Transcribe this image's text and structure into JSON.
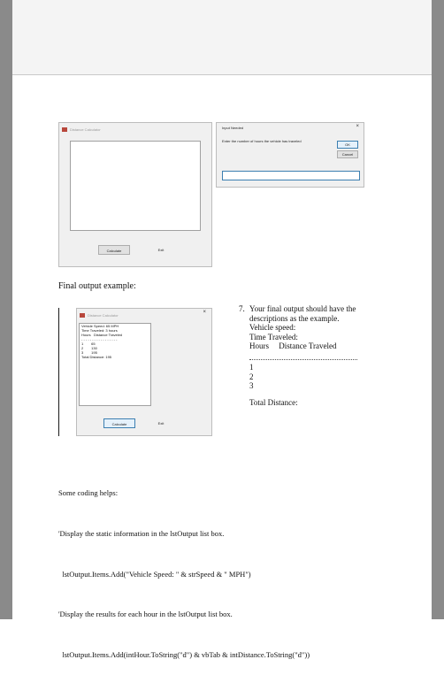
{
  "calc_window": {
    "title": "Distance Calculator",
    "calculate_label": "Calculate",
    "exit_label": "Exit"
  },
  "input_dialog": {
    "title": "Input Needed",
    "close_glyph": "×",
    "prompt": "Enter the number of hours the vehicle has traveled",
    "ok_label": "OK",
    "cancel_label": "Cancel"
  },
  "final_label": "Final output example:",
  "final_window": {
    "title": "Distance Calculator",
    "close_glyph": "×",
    "list_lines": [
      "Vehicle Speed: 65 MPH",
      "Time Traveled: 3 hours",
      "Hours   Distance Traveled",
      "- - - - - - - - - - - - - - - - -",
      "1        65",
      "2        130",
      "3        195",
      "Total Distance: 195"
    ],
    "calculate_label": "Calculate",
    "exit_label": "Exit"
  },
  "note": {
    "number": "7.",
    "lines": [
      "Your final output should have the",
      "descriptions as the example.",
      "Vehicle speed:",
      "Time Traveled:",
      "Hours     Distance Traveled"
    ],
    "hours": [
      "1",
      "2",
      "3"
    ],
    "total": "Total Distance:"
  },
  "helps": [
    "Some coding helps:",
    "'Display the static information in the lstOutput list box.",
    "  lstOutput.Items.Add(\"Vehicle Speed: \" & strSpeed & \" MPH\")",
    "'Display the results for each hour in the lstOutput list box.",
    "  lstOutput.Items.Add(intHour.ToString(\"d\") & vbTab & intDistance.ToString(\"d\"))"
  ]
}
